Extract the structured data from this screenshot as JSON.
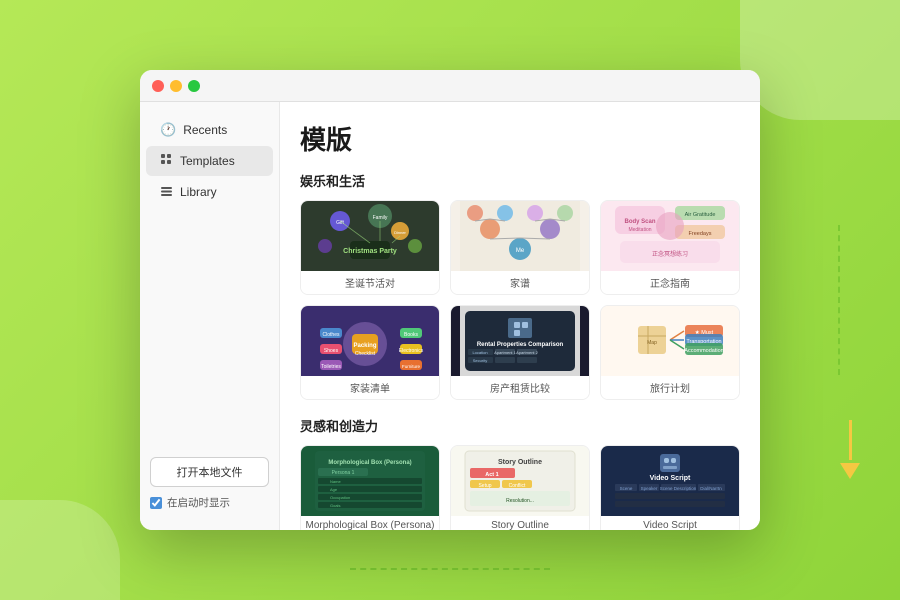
{
  "app": {
    "title": "模版",
    "titlebar": {
      "traffic_red": "close",
      "traffic_yellow": "minimize",
      "traffic_green": "maximize"
    }
  },
  "sidebar": {
    "items": [
      {
        "id": "recents",
        "label": "Recents",
        "icon": "🕐",
        "active": false
      },
      {
        "id": "templates",
        "label": "Templates",
        "icon": "▦",
        "active": true
      },
      {
        "id": "library",
        "label": "Library",
        "icon": "📊",
        "active": false
      }
    ],
    "open_file_btn": "打开本地文件",
    "startup_checkbox_label": "在启动时显示",
    "startup_checked": true
  },
  "main": {
    "page_title": "模版",
    "sections": [
      {
        "id": "entertainment",
        "title": "娱乐和生活",
        "templates": [
          {
            "id": "christmas",
            "label": "圣诞节活对",
            "bg": "#2d3b2d"
          },
          {
            "id": "genealogy",
            "label": "家谱",
            "bg": "#f5f0e8"
          },
          {
            "id": "mindfulness",
            "label": "正念指南",
            "bg": "#fce8f0"
          },
          {
            "id": "packing",
            "label": "家装清单",
            "bg": "#3a2d6e"
          },
          {
            "id": "rental",
            "label": "房产租赁比较",
            "bg": "#e8e8e8"
          },
          {
            "id": "travel",
            "label": "旅行计划",
            "bg": "#fff8f0"
          }
        ]
      },
      {
        "id": "creativity",
        "title": "灵感和创造力",
        "templates": [
          {
            "id": "morpho",
            "label": "Morphological Box (Persona)",
            "bg": "#1a5c3a"
          },
          {
            "id": "story",
            "label": "Story Outline",
            "bg": "#f8f8f0"
          },
          {
            "id": "video",
            "label": "Video Script",
            "bg": "#1a2a4a"
          }
        ]
      }
    ]
  }
}
